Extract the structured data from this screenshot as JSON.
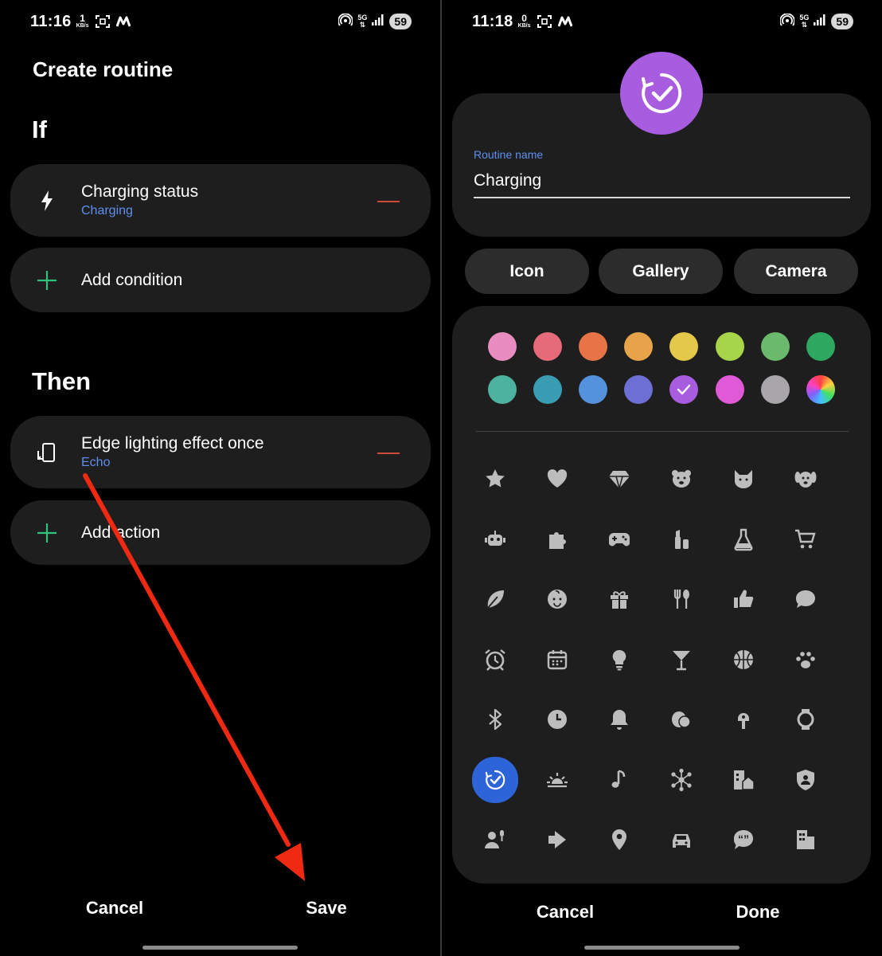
{
  "left": {
    "status": {
      "time": "11:16",
      "kbs_value": "1",
      "kbs_unit": "KB/s",
      "battery": "59",
      "network": "5G"
    },
    "title": "Create routine",
    "if_heading": "If",
    "condition": {
      "title": "Charging status",
      "subtitle": "Charging",
      "icon": "lightning-icon"
    },
    "add_condition": "Add condition",
    "then_heading": "Then",
    "action": {
      "title": "Edge lighting effect once",
      "subtitle": "Echo",
      "icon": "rotate-screen-icon"
    },
    "add_action": "Add action",
    "cancel": "Cancel",
    "save": "Save",
    "annotation_color": "#f02a12"
  },
  "right": {
    "status": {
      "time": "11:18",
      "kbs_value": "0",
      "kbs_unit": "KB/s",
      "battery": "59",
      "network": "5G"
    },
    "avatar_color": "#a85de0",
    "name_label": "Routine name",
    "name_value": "Charging",
    "tabs": [
      "Icon",
      "Gallery",
      "Camera"
    ],
    "colors": [
      "#e98cc0",
      "#e66b78",
      "#e67446",
      "#e8a34a",
      "#e3c84a",
      "#a7d54a",
      "#6ab96c",
      "#2ea860",
      "#4db3a0",
      "#3a9db3",
      "#5592dd",
      "#6e6fd4",
      "#a85de0",
      "#e059d6",
      "#a8a5ab",
      "rainbow"
    ],
    "selected_color_index": 12,
    "icons": [
      "star-icon",
      "heart-icon",
      "diamond-icon",
      "bear-icon",
      "cat-icon",
      "dog-icon",
      "robot-icon",
      "puzzle-icon",
      "gamepad-icon",
      "cosmetics-icon",
      "flask-icon",
      "cart-icon",
      "leaf-icon",
      "baby-icon",
      "gift-icon",
      "cutlery-icon",
      "thumbs-up-icon",
      "chat-bubble-icon",
      "alarm-icon",
      "calendar-icon",
      "bulb-icon",
      "cocktail-icon",
      "basketball-icon",
      "paw-icon",
      "bluetooth-icon",
      "clock-icon",
      "bell-icon",
      "earbuds-icon",
      "earbud-icon",
      "watch-icon",
      "routine-check-icon",
      "sunrise-icon",
      "music-note-icon",
      "molecule-icon",
      "building-home-icon",
      "shield-person-icon",
      "person-mic-icon",
      "enter-icon",
      "location-pin-icon",
      "car-icon",
      "quote-bubble-icon",
      "buildings-icon"
    ],
    "selected_icon_index": 30,
    "cancel": "Cancel",
    "done": "Done"
  }
}
